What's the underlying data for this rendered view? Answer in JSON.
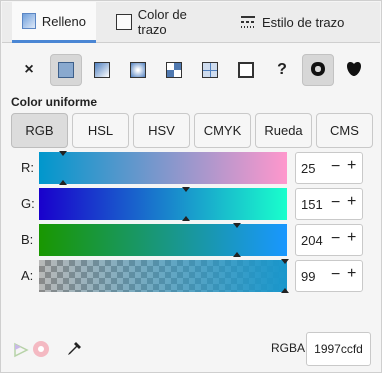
{
  "tabs": [
    {
      "label": "Relleno",
      "active": true,
      "icon": "fill-icon"
    },
    {
      "label": "Color de trazo",
      "active": false,
      "icon": "stroke-paint-icon"
    },
    {
      "label": "Estilo de trazo",
      "active": false,
      "icon": "stroke-style-icon"
    }
  ],
  "fill_types": [
    {
      "name": "no-paint",
      "glyph": "×"
    },
    {
      "name": "flat-color",
      "active": true
    },
    {
      "name": "linear-gradient"
    },
    {
      "name": "radial-gradient"
    },
    {
      "name": "pattern"
    },
    {
      "name": "mesh-gradient"
    },
    {
      "name": "swatch"
    },
    {
      "name": "unset",
      "glyph": "?"
    },
    {
      "name": "fill-rule-evenodd",
      "active": true
    },
    {
      "name": "fill-rule-nonzero"
    }
  ],
  "section_label": "Color uniforme",
  "modes": [
    {
      "label": "RGB",
      "active": true
    },
    {
      "label": "HSL"
    },
    {
      "label": "HSV"
    },
    {
      "label": "CMYK"
    },
    {
      "label": "Rueda"
    },
    {
      "label": "CMS"
    }
  ],
  "channels": [
    {
      "label": "R:",
      "value": "25",
      "fraction": 0.098
    },
    {
      "label": "G:",
      "value": "151",
      "fraction": 0.592
    },
    {
      "label": "B:",
      "value": "204",
      "fraction": 0.8
    },
    {
      "label": "A:",
      "value": "99",
      "fraction": 0.99
    }
  ],
  "spin_minus": "−",
  "spin_plus": "+",
  "rgba_label": "RGBA:",
  "rgba_value": "1997ccfd",
  "colors": {
    "accent": "#4a86d4",
    "current": "#1997cc"
  }
}
